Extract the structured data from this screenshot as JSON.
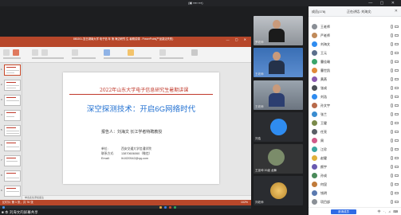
{
  "meeting": {
    "window_title": "(▣ ▪▪▪▪ ▪▪▪)",
    "window_controls": "— ▢ ✕",
    "self_label": "■ 本 刘海文的屏幕共享"
  },
  "ppt": {
    "title": "880201-复日湖南大学 电子信 年 第 海边研究 生 暑期讲课 - PowerPoint(产品激活失败)",
    "controls": "— ▢ ✕",
    "tabs": [
      "文件",
      "开始",
      "插入",
      "设计",
      "切换",
      "动画",
      "幻灯片放映",
      "审阅",
      "视图",
      "帮助"
    ],
    "active_tab": "开始",
    "notes_placeholder": "单击此处添加备注",
    "status": "幻灯片 第 1 张，共 76 张",
    "zoom": "102%",
    "slide": {
      "header": "2022年山东大学电子信息研究生暑期讲课",
      "title": "深空探测技术：开启6G网络时代",
      "reporter": "报告人：刘海文  长江学者特聘教授",
      "info": [
        {
          "label": "单位:",
          "value": "西安交通大学信通学院"
        },
        {
          "label": "联系方式:",
          "value": "13870606060（微信）"
        },
        {
          "label": "Email:",
          "value": "lh1020542@qq.com"
        }
      ]
    }
  },
  "videos": [
    {
      "name": "罗老师"
    },
    {
      "name": "王老师"
    },
    {
      "name": "王老师"
    },
    {
      "name": "刘浩"
    },
    {
      "name": "王延坤 20级 龙舞"
    },
    {
      "name": "刘老师"
    },
    {
      "name": ""
    }
  ],
  "panel": {
    "title": "成员(178)",
    "subtitle": "正在讲话: 刘海文;",
    "search_hint": "成员 (178)",
    "invite_button": "邀请成员",
    "ime": "中 ·, ♫ ⌨",
    "participants": [
      {
        "name": "王老师"
      },
      {
        "name": "严老师"
      },
      {
        "name": "刘海文"
      },
      {
        "name": "王元"
      },
      {
        "name": "曹佳瑜"
      },
      {
        "name": "曹世凯"
      },
      {
        "name": "黄燕"
      },
      {
        "name": "张成"
      },
      {
        "name": "刘浩"
      },
      {
        "name": "孙文宇"
      },
      {
        "name": "张兰"
      },
      {
        "name": "王健"
      },
      {
        "name": "任亮"
      },
      {
        "name": "周"
      },
      {
        "name": "江珍"
      },
      {
        "name": "赵健"
      },
      {
        "name": "颜宇"
      },
      {
        "name": "孙成"
      },
      {
        "name": "何昆"
      },
      {
        "name": "钱明"
      },
      {
        "name": "项目部"
      }
    ]
  }
}
